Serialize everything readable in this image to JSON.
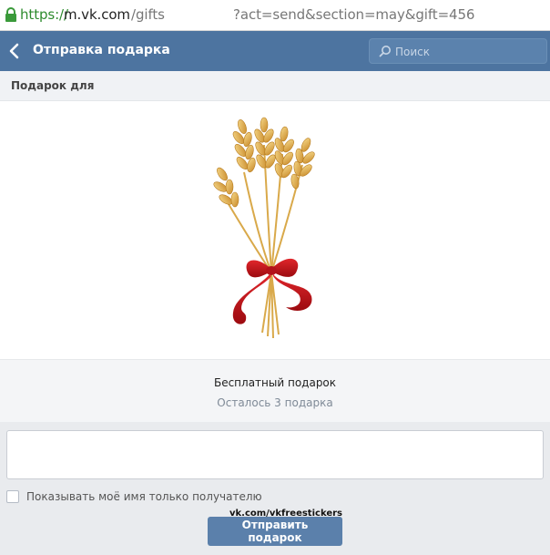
{
  "browser": {
    "url_scheme": "https://",
    "url_host": "m.vk.com",
    "url_path": "/gifts",
    "url_query": "?act=send&section=may&gift=456"
  },
  "header": {
    "title": "Отправка подарка",
    "search_placeholder": "Поиск",
    "icons": [
      "back-arrow-icon",
      "search-icon"
    ]
  },
  "subheader": {
    "label": "Подарок для"
  },
  "gift": {
    "image": "wheat-bundle-with-red-ribbon",
    "title": "Бесплатный подарок",
    "remaining": "Осталось 3 подарка"
  },
  "form": {
    "message_value": "",
    "checkbox_label": "Показывать моё имя только получателю",
    "checkbox_checked": false,
    "watermark": "vk.com/vkfreestickers",
    "send_label": "Отправить подарок"
  },
  "colors": {
    "header_bg": "#4d74a0",
    "button_bg": "#5b80ab",
    "url_scheme": "#2e8b2e"
  }
}
